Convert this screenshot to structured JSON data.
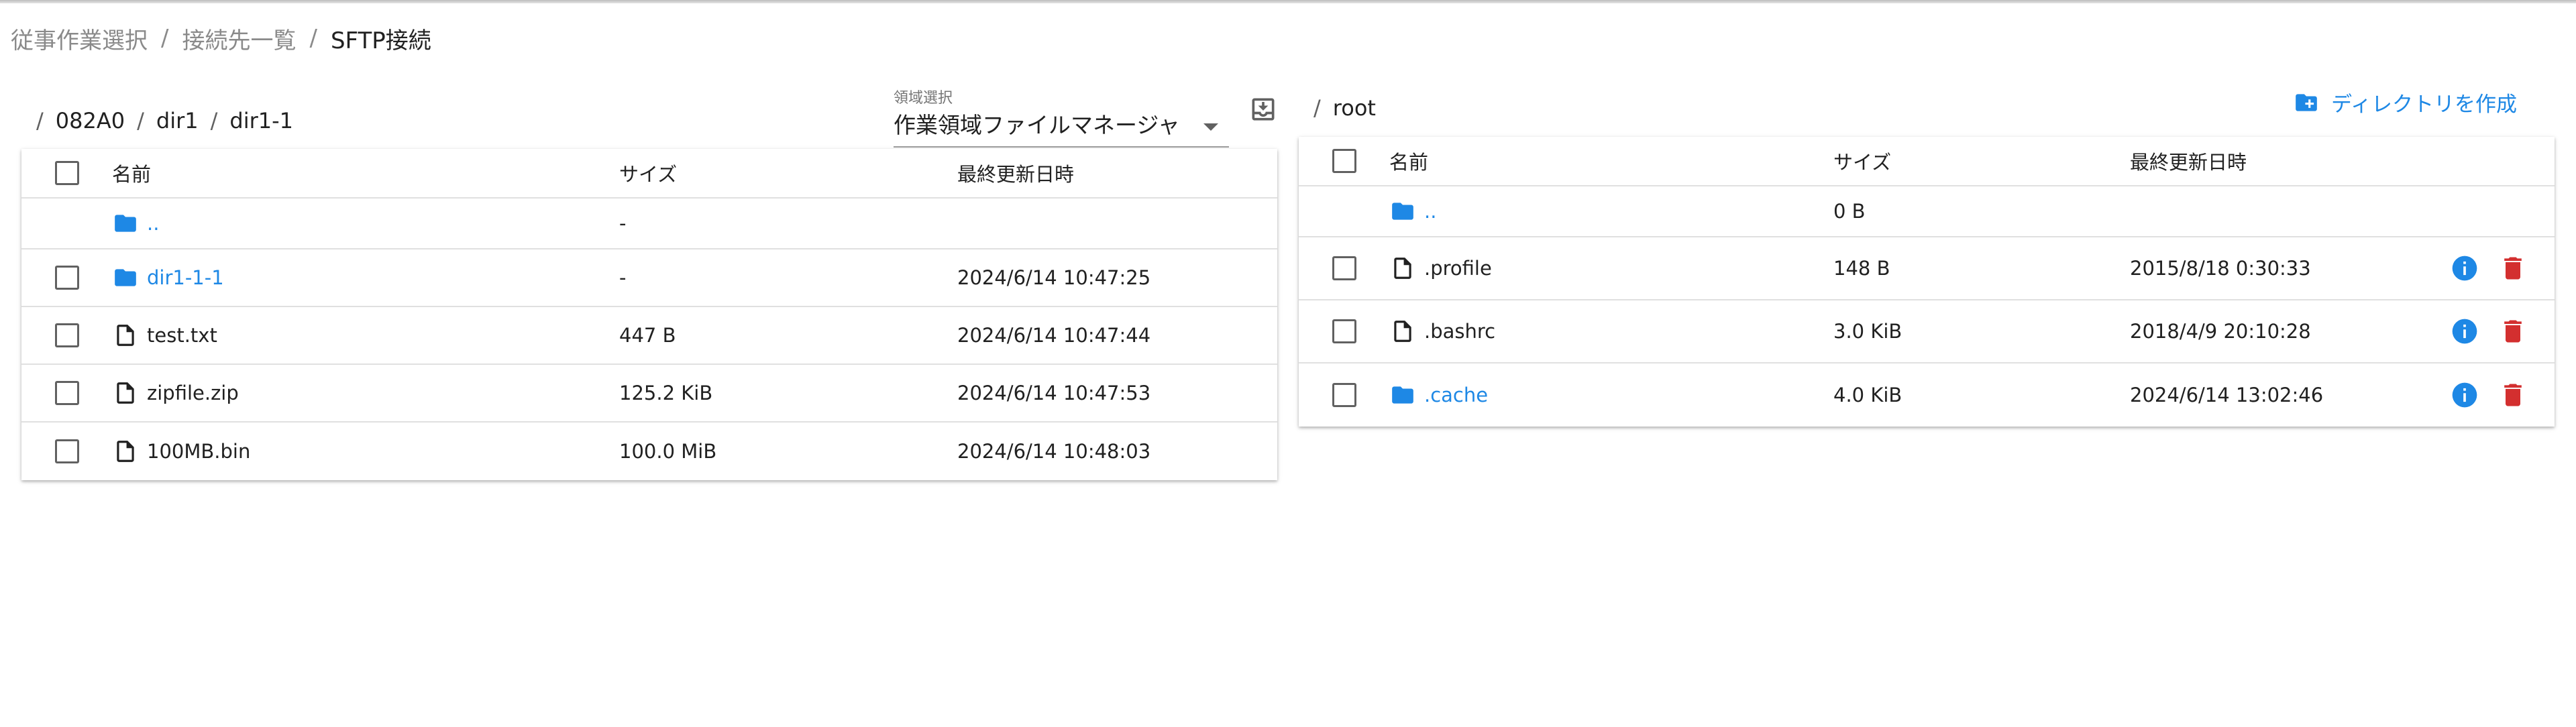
{
  "breadcrumb": [
    "従事作業選択",
    "接続先一覧",
    "SFTP接続"
  ],
  "left": {
    "path": [
      "082A0",
      "dir1",
      "dir1-1"
    ],
    "select": {
      "label": "領域選択",
      "value": "作業領域ファイルマネージャ"
    },
    "columns": {
      "name": "名前",
      "size": "サイズ",
      "modified": "最終更新日時"
    },
    "rows": [
      {
        "name": "..",
        "type": "folder",
        "size": "-",
        "modified": ""
      },
      {
        "name": "dir1-1-1",
        "type": "folder",
        "size": "-",
        "modified": "2024/6/14 10:47:25"
      },
      {
        "name": "test.txt",
        "type": "file",
        "size": "447 B",
        "modified": "2024/6/14 10:47:44"
      },
      {
        "name": "zipfile.zip",
        "type": "file",
        "size": "125.2 KiB",
        "modified": "2024/6/14 10:47:53"
      },
      {
        "name": "100MB.bin",
        "type": "file",
        "size": "100.0 MiB",
        "modified": "2024/6/14 10:48:03"
      }
    ]
  },
  "right": {
    "path": [
      "root"
    ],
    "create_dir_label": "ディレクトリを作成",
    "columns": {
      "name": "名前",
      "size": "サイズ",
      "modified": "最終更新日時"
    },
    "rows": [
      {
        "name": "..",
        "type": "folder",
        "size": "0 B",
        "modified": ""
      },
      {
        "name": ".profile",
        "type": "file",
        "size": "148 B",
        "modified": "2015/8/18 0:30:33"
      },
      {
        "name": ".bashrc",
        "type": "file",
        "size": "3.0 KiB",
        "modified": "2018/4/9 20:10:28"
      },
      {
        "name": ".cache",
        "type": "folder",
        "size": "4.0 KiB",
        "modified": "2024/6/14 13:02:46"
      }
    ]
  },
  "icons": {
    "folder": "folder-icon",
    "file": "file-icon",
    "info": "info-icon",
    "delete": "delete-icon",
    "download": "download-icon",
    "create_folder": "create-folder-icon"
  },
  "colors": {
    "accent": "#1e88e5",
    "danger": "#d32f2f"
  }
}
